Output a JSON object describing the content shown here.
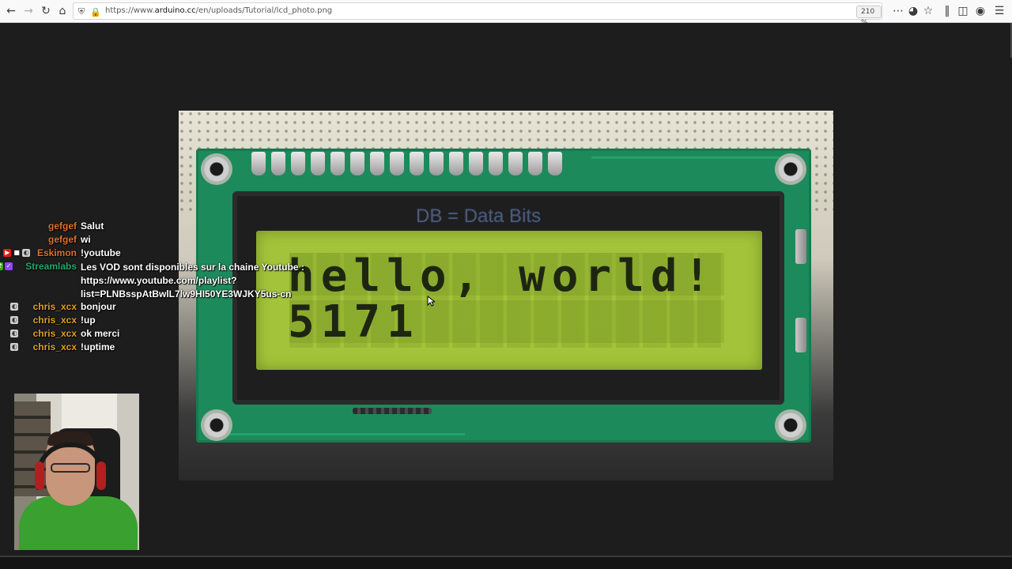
{
  "browser": {
    "url_prefix": "https://www.",
    "url_host": "arduino.cc",
    "url_path": "/en/uploads/Tutorial/lcd_photo.png",
    "zoom_level": "210 %",
    "icons": [
      "back-arrow-icon",
      "forward-arrow-icon",
      "reload-icon",
      "home-icon",
      "shield-icon",
      "lock-icon",
      "more-menu-icon",
      "pocket-icon",
      "bookmark-star-icon",
      "library-icon",
      "sidebar-icon",
      "account-icon",
      "hamburger-menu-icon"
    ]
  },
  "photo": {
    "annotation": "DB = Data Bits",
    "lcd_line1": "hello, world!",
    "lcd_line2": "5171"
  },
  "chat": {
    "messages": [
      {
        "user": "gefgef",
        "text": "Salut",
        "color": "#e0702a",
        "badges": []
      },
      {
        "user": "gefgef",
        "text": "wi",
        "color": "#e0702a",
        "badges": []
      },
      {
        "user": "Eskimon",
        "text": "!youtube",
        "color": "#e0702a",
        "badges": [
          "broadcaster",
          "mod-sword",
          "glitch"
        ]
      },
      {
        "user": "Streamlabs",
        "lines": [
          "Les VOD sont disponibles sur la chaine Youtube :",
          "https://www.youtube.com/playlist?",
          "list=PLNBsspAtBwlL7lw9HI50YE3WJKY5us-cn"
        ],
        "color": "#21a96e",
        "badges": [
          "mod",
          "verified"
        ]
      },
      {
        "user": "chris_xcx",
        "text": "bonjour",
        "color": "#e0a020",
        "badges": [
          "glitch"
        ]
      },
      {
        "user": "chris_xcx",
        "text": "!up",
        "color": "#e0a020",
        "badges": [
          "glitch"
        ]
      },
      {
        "user": "chris_xcx",
        "text": "ok merci",
        "color": "#e0a020",
        "badges": [
          "glitch"
        ]
      },
      {
        "user": "chris_xcx",
        "text": "!uptime",
        "color": "#e0a020",
        "badges": [
          "glitch"
        ]
      }
    ]
  }
}
